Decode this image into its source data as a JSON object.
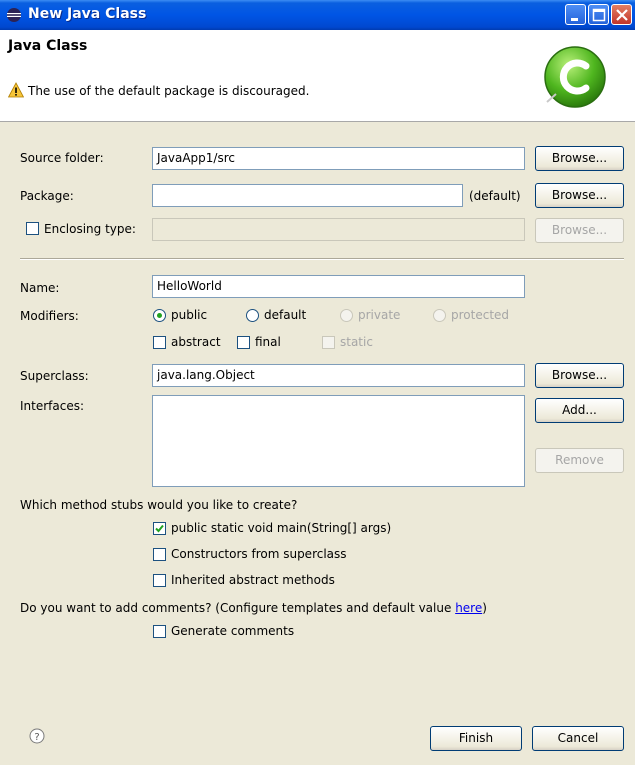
{
  "window": {
    "title": "New Java Class"
  },
  "banner": {
    "title": "Java Class",
    "message": "The use of the default package is discouraged."
  },
  "form": {
    "source_folder": {
      "label": "Source folder:",
      "value": "JavaApp1/src",
      "button": "Browse..."
    },
    "package": {
      "label": "Package:",
      "value": "",
      "suffix": "(default)",
      "button": "Browse..."
    },
    "enclosing_type": {
      "label": "Enclosing type:",
      "checked": false,
      "value": "",
      "button": "Browse..."
    },
    "name": {
      "label": "Name:",
      "value": "HelloWorld"
    },
    "modifiers": {
      "label": "Modifiers:",
      "radios": [
        {
          "label": "public",
          "selected": true,
          "enabled": true
        },
        {
          "label": "default",
          "selected": false,
          "enabled": true
        },
        {
          "label": "private",
          "selected": false,
          "enabled": false
        },
        {
          "label": "protected",
          "selected": false,
          "enabled": false
        }
      ],
      "checkboxes": [
        {
          "label": "abstract",
          "checked": false,
          "enabled": true
        },
        {
          "label": "final",
          "checked": false,
          "enabled": true
        },
        {
          "label": "static",
          "checked": false,
          "enabled": false
        }
      ]
    },
    "superclass": {
      "label": "Superclass:",
      "value": "java.lang.Object",
      "button": "Browse..."
    },
    "interfaces": {
      "label": "Interfaces:",
      "add_button": "Add...",
      "remove_button": "Remove"
    },
    "method_stubs": {
      "question": "Which method stubs would you like to create?",
      "options": [
        {
          "label": "public static void main(String[] args)",
          "checked": true
        },
        {
          "label": "Constructors from superclass",
          "checked": false
        },
        {
          "label": "Inherited abstract methods",
          "checked": false
        }
      ]
    },
    "comments": {
      "question": "Do you want to add comments? (Configure templates and default value ",
      "link": "here",
      "question_end": ")",
      "option": {
        "label": "Generate comments",
        "checked": false
      }
    }
  },
  "footer": {
    "finish_button": "Finish",
    "cancel_button": "Cancel"
  },
  "colors": {
    "title_bar": "#0055e5",
    "dialog_bg": "#ece9d8",
    "check_green": "#21a121",
    "link": "#0000ee"
  }
}
